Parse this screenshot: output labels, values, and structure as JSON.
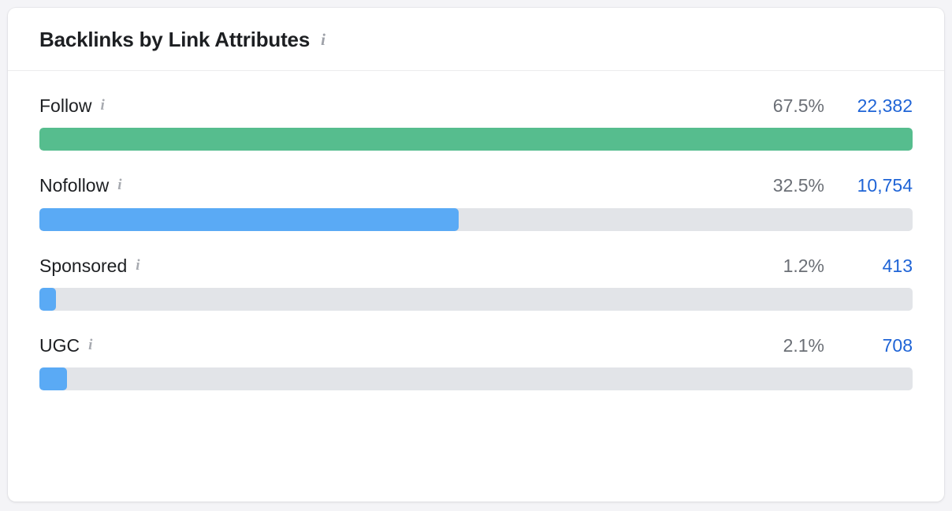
{
  "card": {
    "title": "Backlinks by Link Attributes",
    "title_info_icon": "info-icon",
    "accent_blue": "#5aaaf5",
    "accent_green": "#56bd8e",
    "track_color": "#e2e4e8",
    "count_link_color": "#1f64d6",
    "percent_color": "#6b6f76"
  },
  "chart_data": {
    "type": "bar",
    "title": "Backlinks by Link Attributes",
    "orientation": "horizontal",
    "xlabel": "",
    "ylabel": "",
    "categories": [
      "Follow",
      "Nofollow",
      "Sponsored",
      "UGC"
    ],
    "values": [
      22382,
      10754,
      413,
      708
    ],
    "value_labels": [
      "22,382",
      "10,754",
      "413",
      "708"
    ],
    "percents": [
      67.5,
      32.5,
      1.2,
      2.1
    ],
    "percent_labels": [
      "67.5%",
      "32.5%",
      "1.2%",
      "2.1%"
    ],
    "bar_fill_widths_pct": [
      100,
      48,
      1.9,
      3.2
    ],
    "bar_colors": [
      "#56bd8e",
      "#5aaaf5",
      "#5aaaf5",
      "#5aaaf5"
    ],
    "grid": false,
    "legend": false
  },
  "rows": [
    {
      "label": "Follow",
      "info_icon": "info-icon",
      "percent": "67.5%",
      "count": "22,382"
    },
    {
      "label": "Nofollow",
      "info_icon": "info-icon",
      "percent": "32.5%",
      "count": "10,754"
    },
    {
      "label": "Sponsored",
      "info_icon": "info-icon",
      "percent": "1.2%",
      "count": "413"
    },
    {
      "label": "UGC",
      "info_icon": "info-icon",
      "percent": "2.1%",
      "count": "708"
    }
  ]
}
